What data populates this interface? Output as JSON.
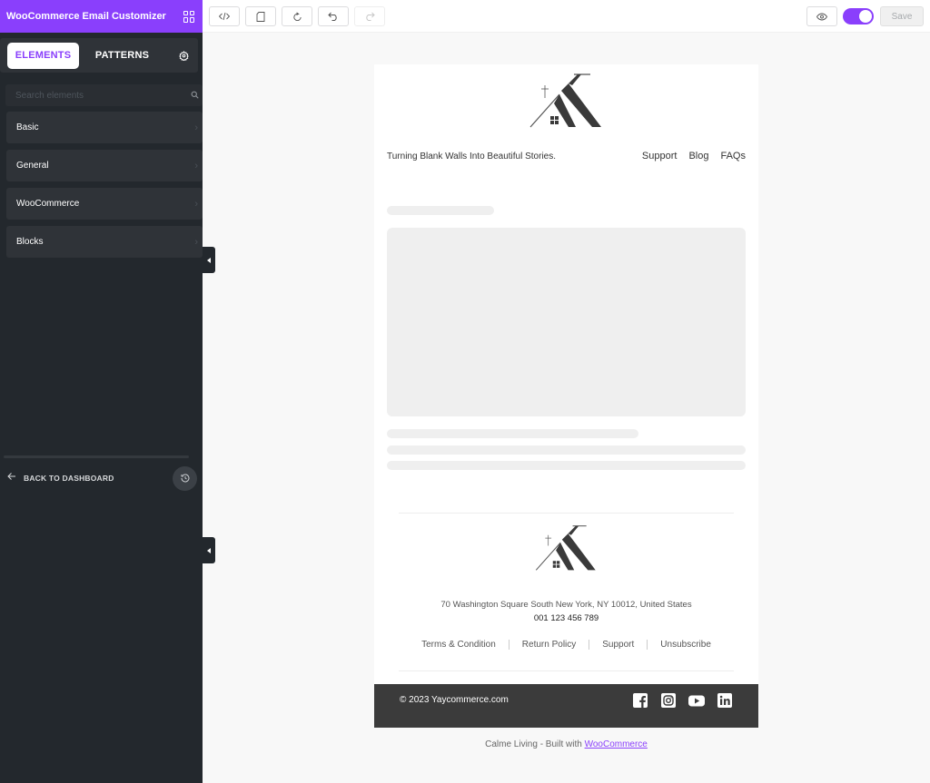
{
  "app": {
    "title": "WooCommerce Email Customizer"
  },
  "sidebar": {
    "tabs": [
      {
        "label": "ELEMENTS"
      },
      {
        "label": "PATTERNS"
      }
    ],
    "search": {
      "placeholder": "Search elements"
    },
    "categories": [
      {
        "label": "Basic"
      },
      {
        "label": "General"
      },
      {
        "label": "WooCommerce"
      },
      {
        "label": "Blocks"
      }
    ],
    "back_label": "BACK TO DASHBOARD"
  },
  "toolbar": {
    "save_label": "Save",
    "preview_toggle_on": true
  },
  "email": {
    "tagline": "Turning Blank Walls Into Beautiful Stories.",
    "nav": [
      {
        "label": "Support"
      },
      {
        "label": "Blog"
      },
      {
        "label": "FAQs"
      }
    ],
    "footer": {
      "address": "70 Washington Square South New York, NY 10012, United States",
      "phone": "001 123 456 789",
      "links": [
        {
          "label": "Terms & Condition"
        },
        {
          "label": "Return Policy"
        },
        {
          "label": "Support"
        },
        {
          "label": "Unsubscribe"
        }
      ],
      "copyright": "© 2023 Yaycommerce.com",
      "socials": [
        "facebook-icon",
        "instagram-icon",
        "youtube-icon",
        "linkedin-icon"
      ]
    }
  },
  "built_with": {
    "prefix": "Calme Living - Built with ",
    "link": "WooCommerce"
  },
  "colors": {
    "accent": "#8a3ffc",
    "sidebar_bg": "#23282d",
    "footer_bar": "#3b3b3b"
  }
}
